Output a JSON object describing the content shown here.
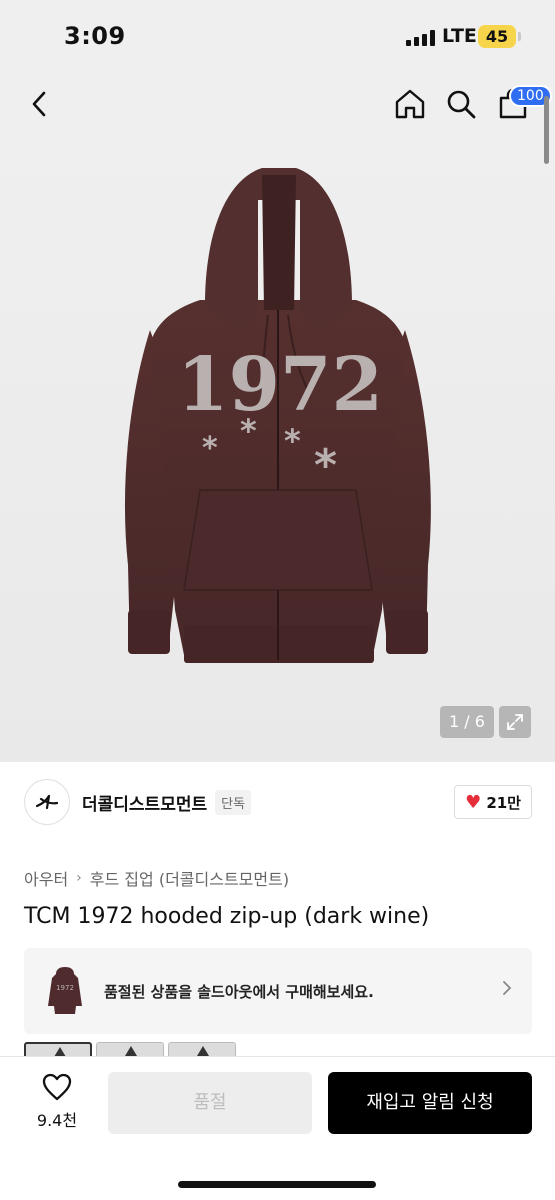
{
  "status_bar": {
    "time": "3:09",
    "network": "LTE",
    "battery": "45"
  },
  "nav": {
    "cart_count": "100"
  },
  "gallery": {
    "counter": "1 / 6"
  },
  "brand": {
    "name": "더콜디스트모먼트",
    "tag": "단독",
    "likes": "21만"
  },
  "breadcrumb": {
    "category": "아우터",
    "subcategory": "후드 집업 (더콜디스트모먼트)"
  },
  "product": {
    "title": "TCM 1972 hooded zip-up (dark wine)",
    "graphic_text": "1972"
  },
  "soldout_banner": {
    "text": "품절된 상품을 솔드아웃에서 구매해보세요."
  },
  "bottom": {
    "wish_count": "9.4천",
    "soldout_label": "품절",
    "restock_label": "재입고 알림 신청"
  },
  "colors": {
    "accent_blue": "#2f6ef2",
    "heart_red": "#e62e3b",
    "hoodie_wine": "#4f2b2d",
    "battery_yellow": "#f6d54a"
  }
}
